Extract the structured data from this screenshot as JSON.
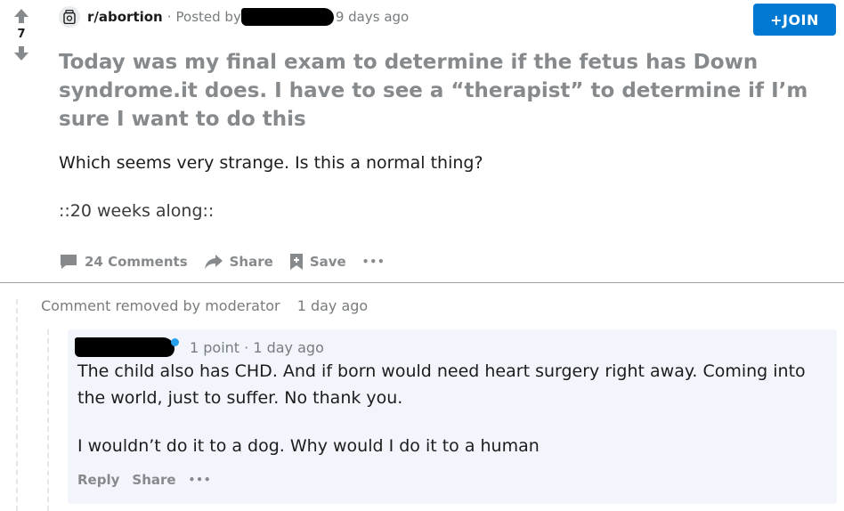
{
  "vote": {
    "score": "7"
  },
  "post": {
    "subreddit": "r/abortion",
    "posted_by_prefix": "Posted by",
    "age": "9 days ago",
    "join_label": "+JOIN",
    "title": "Today was my final exam to determine if the fetus has Down syndrome.it does. I have to see a “therapist” to determine if I’m sure I want to do this",
    "body_1": "Which seems very strange. Is this a normal thing?",
    "body_2": "::20 weeks along::",
    "actions": {
      "comments": "24 Comments",
      "share": "Share",
      "save": "Save",
      "more": "•••"
    }
  },
  "removed_comment": {
    "text": "Comment removed by moderator",
    "age": "1 day ago"
  },
  "reply": {
    "meta": "1 point · 1 day ago",
    "text_1": "The child also has CHD. And if born would need heart surgery right away. Coming into the world, just to suffer. No thank you.",
    "text_2": "I wouldn’t do it to a dog. Why would I do it to a human",
    "actions": {
      "reply": "Reply",
      "share": "Share",
      "more": "•••"
    }
  },
  "colors": {
    "accent": "#0079d3",
    "muted": "#878a8c",
    "reply_bg": "#f2f6fc"
  },
  "icons": [
    "upvote-icon",
    "downvote-icon",
    "subreddit-icon",
    "comment-icon",
    "share-icon",
    "save-icon",
    "more-icon"
  ]
}
